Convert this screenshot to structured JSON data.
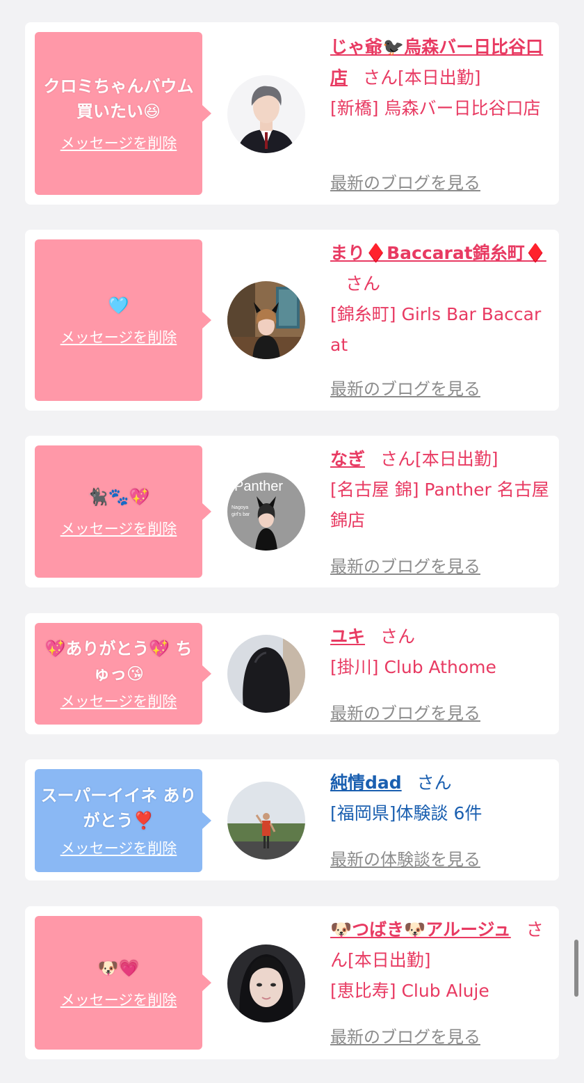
{
  "delete_label": "メッセージを削除",
  "blog_label": "最新のブログを見る",
  "experience_label": "最新の体験談を見る",
  "honorific": "さん",
  "on_duty_label": "[本日出勤]",
  "colors": {
    "pink_bubble": "#ff98a8",
    "blue_bubble": "#8ab8f4",
    "name_pink": "#e83a62",
    "name_blue": "#1a5fb0"
  },
  "cards": [
    {
      "message": "クロミちゃんバウム買いたい😆",
      "name": "じゃ爺🐦‍⬛烏森バー日比谷口店",
      "on_duty": true,
      "location": "[新橋] 烏森バー日比谷口店",
      "link": "最新のブログを見る",
      "bubble": "pink",
      "avatar_icon": "avatar-man-suit"
    },
    {
      "message": "🩵",
      "name": "まり♦️Baccarat錦糸町♦️",
      "on_duty": false,
      "location": "[錦糸町] Girls Bar Baccarat",
      "link": "最新のブログを見る",
      "bubble": "pink",
      "avatar_icon": "avatar-woman-room"
    },
    {
      "message": "🐈‍⬛🐾💖",
      "name": "なぎ",
      "on_duty": true,
      "location": "[名古屋 錦] Panther 名古屋錦店",
      "link": "最新のブログを見る",
      "bubble": "pink",
      "avatar_icon": "avatar-panther-logo",
      "avatar_text": [
        "Panther",
        "Nagoya",
        "girl's bar"
      ]
    },
    {
      "message": "💖ありがとう💖 ちゅっ😘",
      "name": "ユキ",
      "on_duty": false,
      "location": "[掛川] Club Athome",
      "link": "最新のブログを見る",
      "bubble": "pink",
      "avatar_icon": "avatar-hair-back"
    },
    {
      "message": "スーパーイイネ ありがとう❣️",
      "name": "純情dad",
      "on_duty": false,
      "location": "[福岡県]体験談 6件",
      "link": "最新の体験談を見る",
      "bubble": "blue",
      "avatar_icon": "avatar-runner-park"
    },
    {
      "message": "🐶💗",
      "name": "🐶つばき🐶アルージュ",
      "on_duty": true,
      "location": "[恵比寿] Club Aluje",
      "link": "最新のブログを見る",
      "bubble": "pink",
      "avatar_icon": "avatar-woman-portrait"
    }
  ]
}
